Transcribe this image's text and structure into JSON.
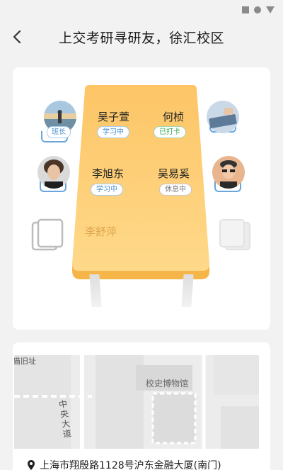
{
  "header": {
    "title": "上交考研寻研友，徐汇校区"
  },
  "seats": [
    {
      "name": "吴子萱",
      "status": "学习中",
      "badge": "班长"
    },
    {
      "name": "何桢",
      "status": "已打卡"
    },
    {
      "name": "李旭东",
      "status": "学习中"
    },
    {
      "name": "吴易奚",
      "status": "休息中"
    },
    {
      "name": "李舒萍"
    }
  ],
  "map": {
    "label_top": "猫旧址",
    "label_museum": "校史博物馆",
    "label_road": "中央大道"
  },
  "address": "上海市翔殷路1128号沪东金融大厦(南门)",
  "colors": {
    "table_top": "#fdcf74",
    "table_edge": "#f6b548",
    "accent_blue": "#4a8ed1",
    "green": "#36a852"
  }
}
